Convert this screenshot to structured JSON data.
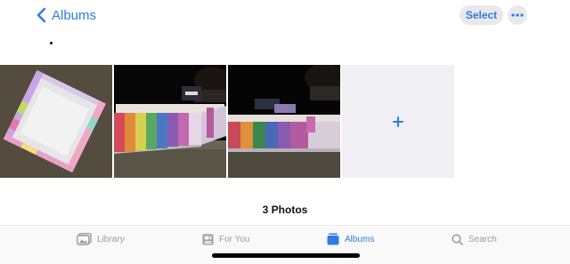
{
  "header": {
    "back_label": "Albums",
    "select_label": "Select",
    "more_icon": "ellipsis-icon"
  },
  "grid": {
    "photos": [
      {
        "name": "photo-1",
        "subject": "white tray with rainbow border on carpet"
      },
      {
        "name": "photo-2",
        "subject": "rainbow box on carpet at night"
      },
      {
        "name": "photo-3",
        "subject": "rainbow box on carpet at night"
      }
    ],
    "add_icon": "plus-icon"
  },
  "photo_count": "3 Photos",
  "tabs": [
    {
      "label": "Library",
      "icon": "photo-library-icon",
      "active": false
    },
    {
      "label": "For You",
      "icon": "for-you-icon",
      "active": false
    },
    {
      "label": "Albums",
      "icon": "albums-icon",
      "active": true
    },
    {
      "label": "Search",
      "icon": "search-icon",
      "active": false
    }
  ],
  "colors": {
    "accent": "#2f7ae5",
    "inactive": "#9a9a9a",
    "chip": "#e9e9eb"
  }
}
